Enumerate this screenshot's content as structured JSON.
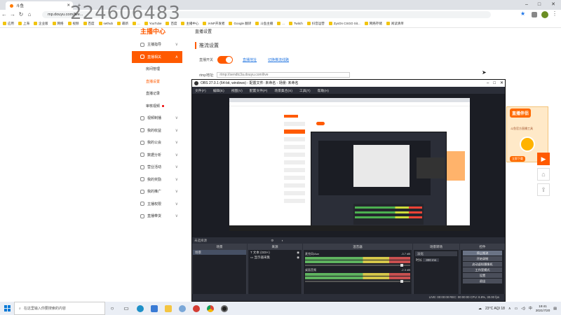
{
  "watermark": "224606483",
  "browser": {
    "tab_title": "斗鱼",
    "url": "mp.douyu.com/live...",
    "bookmarks": [
      "应用",
      "上海",
      "企业版",
      "网络",
      "视频",
      "百度",
      "sethub",
      "最新",
      "...",
      "YouTube",
      "百度",
      "主播中心",
      "IANP开发者",
      "Google 翻译",
      "斗鱼主播",
      "...",
      "Twitch",
      "抖音运营",
      "ZyxOn CSGO Sit...",
      "网络存储",
      "阅读清单"
    ]
  },
  "sidebar": {
    "title": "主播中心",
    "items": [
      {
        "label": "主播指导",
        "expanded": false
      },
      {
        "label": "直播相关",
        "expanded": true,
        "active": true
      },
      {
        "label": "房间管理",
        "sub": true
      },
      {
        "label": "直播设置",
        "sub": true,
        "selected": true
      },
      {
        "label": "直播记录",
        "sub": true
      },
      {
        "label": "审核视频",
        "sub": true,
        "badge": true
      },
      {
        "label": "视频制播"
      },
      {
        "label": "我的收益"
      },
      {
        "label": "我的公会"
      },
      {
        "label": "数据分析"
      },
      {
        "label": "营业活动"
      },
      {
        "label": "我的奖励"
      },
      {
        "label": "我的推广"
      },
      {
        "label": "主播权限"
      },
      {
        "label": "直播带货"
      }
    ]
  },
  "main": {
    "breadcrumb": "直播设置",
    "section_title": "推流设置",
    "push_switch_label": "直播开关",
    "link1": "直播地址",
    "link2": "切换推流线路",
    "rtmp_label": "rtmp地址:",
    "rtmp_value": "rtmp://sendtc3a.douyu.com/live"
  },
  "ad": {
    "title": "直播伴侣",
    "text": "斗鱼官方直播工具",
    "button": "立即下载"
  },
  "obs": {
    "title": "OBS 27.0.1 (64-bit, windows) - 配置文件: 未命名 - 场景: 未命名",
    "menu": [
      "文件(F)",
      "编辑(E)",
      "视图(V)",
      "配置文件(P)",
      "场景集合(S)",
      "工具(T)",
      "帮助(H)"
    ],
    "source_bar": "未选择源",
    "docks": {
      "scenes": {
        "title": "场景",
        "items": [
          "场景"
        ]
      },
      "sources": {
        "title": "来源",
        "items": [
          "文本 (GDI+)",
          "显示器采集"
        ]
      },
      "mixer": {
        "title": "混音器",
        "channels": [
          {
            "name": "麦克风/Aux",
            "db": "-3.7 dB"
          },
          {
            "name": "桌面音频",
            "db": "-2.3 dB"
          }
        ]
      },
      "transitions": {
        "title": "场景转场",
        "type": "淡化",
        "duration_label": "时长",
        "duration": "300 ms"
      },
      "controls": {
        "title": "控件",
        "buttons": [
          "停止推流",
          "开始录制",
          "启动虚拟摄像机",
          "工作室模式",
          "设置",
          "退出"
        ]
      }
    },
    "status": "LIVE: 00:00:00   REC: 00:00:00   CPU: 8.8%, 30.00 fps"
  },
  "taskbar": {
    "search_placeholder": "在这里输入你要搜索的内容",
    "weather": "23°C AQI 18",
    "time": "19:41",
    "date": "2021/7/20"
  }
}
